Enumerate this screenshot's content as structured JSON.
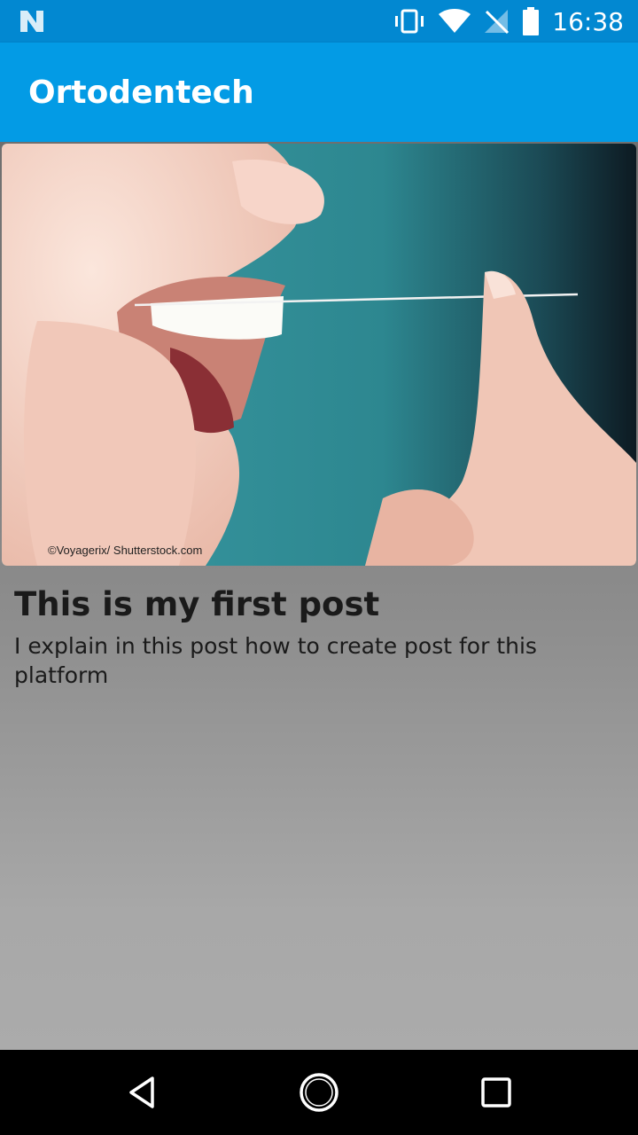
{
  "status_bar": {
    "time": "16:38",
    "icons": [
      "n-logo-icon",
      "vibrate-icon",
      "wifi-icon",
      "no-sim-icon",
      "battery-icon"
    ]
  },
  "app_bar": {
    "title": "Ortodentech"
  },
  "post": {
    "image_alt": "Woman flossing teeth",
    "image_credit": "©Voyagerix/ Shutterstock.com",
    "title": "This is my first post",
    "body": "I explain in this post how to create post for this platform"
  },
  "nav_bar": {
    "icons": [
      "back-icon",
      "home-icon",
      "recents-icon"
    ]
  },
  "colors": {
    "status_bar": "#0288d1",
    "app_bar": "#039be5",
    "nav_bar": "#000000"
  }
}
